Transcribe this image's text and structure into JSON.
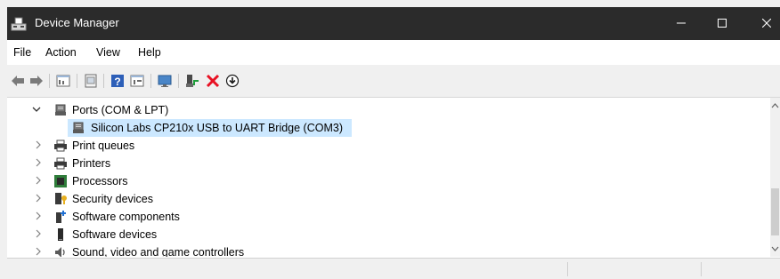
{
  "window": {
    "title": "Device Manager"
  },
  "menu": {
    "file": "File",
    "action": "Action",
    "view": "View",
    "help": "Help"
  },
  "toolbar": {
    "icons": [
      "back-icon",
      "forward-icon",
      "properties-icon",
      "update-driver-icon",
      "help-icon",
      "show-hidden-icon",
      "monitor-icon",
      "enable-device-icon",
      "uninstall-device-icon",
      "download-driver-icon"
    ]
  },
  "tree": {
    "items": [
      {
        "label": "Ports (COM & LPT)",
        "expanded": true,
        "icon": "port-icon"
      },
      {
        "label": "Silicon Labs CP210x USB to UART Bridge (COM3)",
        "selected": true,
        "icon": "port-device-icon"
      },
      {
        "label": "Print queues",
        "expanded": false,
        "icon": "print-queue-icon"
      },
      {
        "label": "Printers",
        "expanded": false,
        "icon": "printer-icon"
      },
      {
        "label": "Processors",
        "expanded": false,
        "icon": "processor-icon"
      },
      {
        "label": "Security devices",
        "expanded": false,
        "icon": "security-device-icon"
      },
      {
        "label": "Software components",
        "expanded": false,
        "icon": "software-component-icon"
      },
      {
        "label": "Software devices",
        "expanded": false,
        "icon": "software-device-icon"
      },
      {
        "label": "Sound, video and game controllers",
        "expanded": false,
        "icon": "speaker-icon"
      }
    ]
  },
  "colors": {
    "titlebar": "#2b2b2b",
    "selection": "#cce8ff",
    "uninstall_red": "#e81123",
    "help_blue": "#2d5fb8",
    "enable_green": "#1e9e3a"
  }
}
